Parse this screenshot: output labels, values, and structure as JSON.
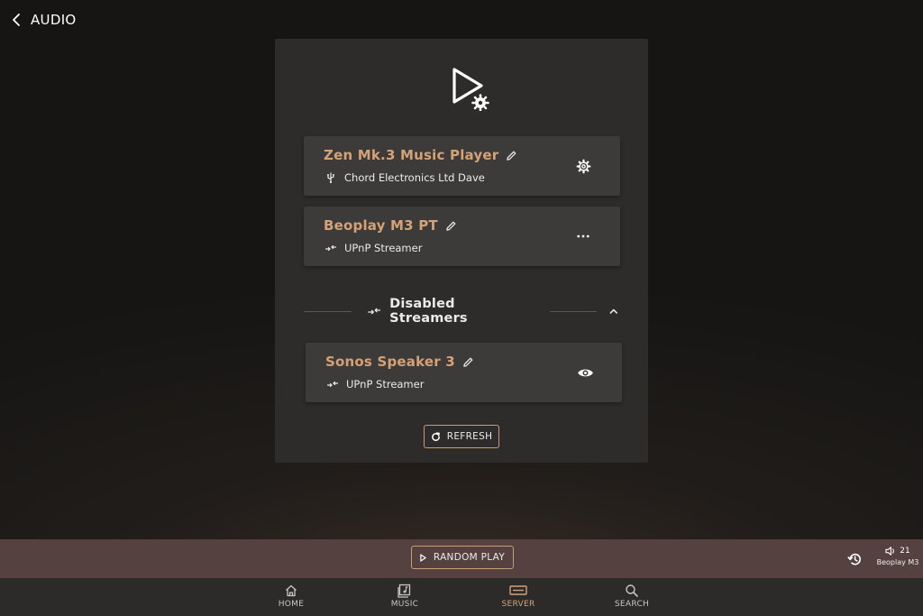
{
  "header": {
    "back_label": "AUDIO"
  },
  "zones": [
    {
      "name": "Zen Mk.3 Music Player",
      "subtitle": "Chord Electronics Ltd Dave",
      "type_icon": "usb-icon",
      "action_icon": "gear-icon"
    },
    {
      "name": "Beoplay M3 PT",
      "subtitle": "UPnP Streamer",
      "type_icon": "streamer-icon",
      "action_icon": "more-horizontal-icon"
    }
  ],
  "disabled_section": {
    "title": "Disabled Streamers",
    "expanded": true
  },
  "disabled_zones": [
    {
      "name": "Sonos Speaker 3",
      "subtitle": "UPnP Streamer",
      "type_icon": "streamer-icon",
      "action_icon": "eye-icon"
    }
  ],
  "refresh_label": "REFRESH",
  "now_playing": {
    "random_play_label": "RANDOM PLAY",
    "volume": "21",
    "zone_name": "Beoplay M3"
  },
  "nav": {
    "items": [
      {
        "label": "HOME",
        "icon": "home-icon",
        "active": false
      },
      {
        "label": "MUSIC",
        "icon": "music-icon",
        "active": false
      },
      {
        "label": "SERVER",
        "icon": "server-icon",
        "active": true
      },
      {
        "label": "SEARCH",
        "icon": "search-icon",
        "active": false
      }
    ]
  },
  "colors": {
    "accent": "#d4a276",
    "panel": "#2d2c2b",
    "card": "#3c3b3a",
    "bar": "#55413f",
    "nav": "#2c2b2a"
  }
}
